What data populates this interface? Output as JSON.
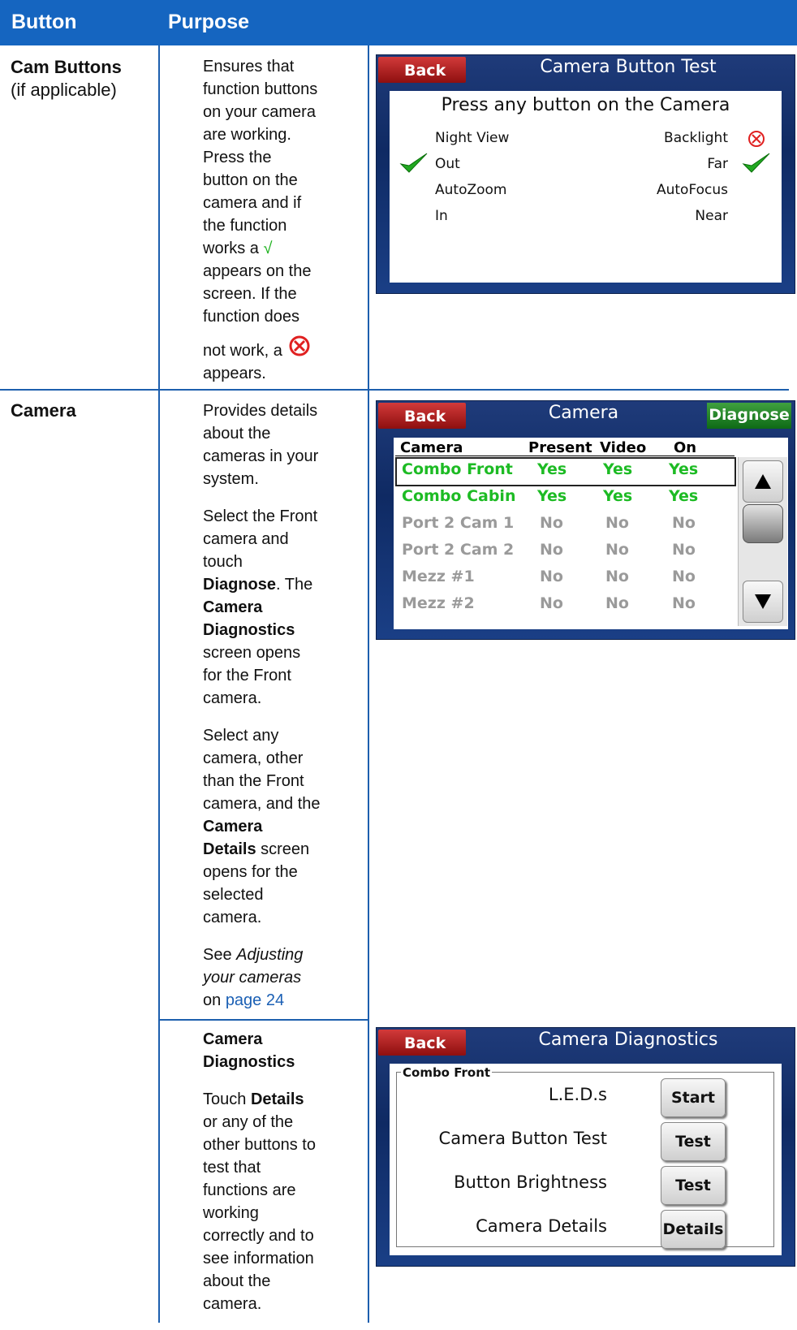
{
  "header": {
    "col_button": "Button",
    "col_purpose": "Purpose"
  },
  "rows": [
    {
      "button_label": "Cam Buttons",
      "button_note": "(if applicable)",
      "purpose_lines": [
        "Ensures that",
        "function buttons",
        "on your camera",
        "are working.",
        "Press the",
        "button on the",
        "camera and if",
        "the function",
        "works a"
      ],
      "check_glyph": "√",
      "purpose_lines_2": [
        "appears on the",
        "screen. If the",
        "function does"
      ],
      "not_work": "not work, a",
      "appears": "appears.",
      "screen": {
        "back": "Back",
        "title": "Camera Button Test",
        "prompt": "Press any button on the Camera",
        "left_items": [
          "Night View",
          "Out",
          "AutoZoom",
          "In"
        ],
        "right_items": [
          "Backlight",
          "Far",
          "AutoFocus",
          "Near"
        ]
      }
    },
    {
      "button_label": "Camera",
      "p1": [
        "Provides details",
        "about the",
        "cameras in your",
        "system."
      ],
      "p2_a": [
        "Select the Front",
        "camera and",
        "touch"
      ],
      "p2_bold1": "Diagnose",
      "p2_tail1": ". The",
      "p2_bold2": "Camera",
      "p2_bold3": "Diagnostics",
      "p2_b": [
        "screen opens",
        "for the Front",
        "camera."
      ],
      "p3_a": [
        "Select any",
        "camera, other",
        "than the Front",
        "camera, and the"
      ],
      "p3_bold1": "Camera",
      "p3_bold2": "Details",
      "p3_tail": " screen",
      "p3_b": [
        "opens for the",
        "selected",
        "camera."
      ],
      "see": " See ",
      "see_italic_1": "Adjusting",
      "see_italic_2": "your cameras",
      "on": "on ",
      "page_link": "page 24",
      "screen": {
        "back": "Back",
        "title": "Camera",
        "diagnose": "Diagnose",
        "columns": [
          "Camera",
          "Present",
          "Video",
          "On"
        ],
        "rows": [
          [
            "Combo Front",
            "Yes",
            "Yes",
            "Yes"
          ],
          [
            "Combo Cabin",
            "Yes",
            "Yes",
            "Yes"
          ],
          [
            "Port 2 Cam 1",
            "No",
            "No",
            "No"
          ],
          [
            "Port 2 Cam 2",
            "No",
            "No",
            "No"
          ],
          [
            "Mezz #1",
            "No",
            "No",
            "No"
          ],
          [
            "Mezz #2",
            "No",
            "No",
            "No"
          ]
        ]
      }
    },
    {
      "title_1": "Camera",
      "title_2": "Diagnostics",
      "touch": "Touch ",
      "details_bold": "Details",
      "lines": [
        "or any of the",
        "other buttons to",
        "test that",
        "functions are",
        "working",
        "correctly and to",
        "see information",
        "about the",
        "camera."
      ],
      "screen": {
        "back": "Back",
        "title": "Camera Diagnostics",
        "group": "Combo Front",
        "items": [
          {
            "label": "L.E.D.s",
            "button": "Start"
          },
          {
            "label": "Camera Button Test",
            "button": "Test"
          },
          {
            "label": "Button Brightness",
            "button": "Test"
          },
          {
            "label": "Camera Details",
            "button": "Details"
          }
        ]
      }
    }
  ]
}
